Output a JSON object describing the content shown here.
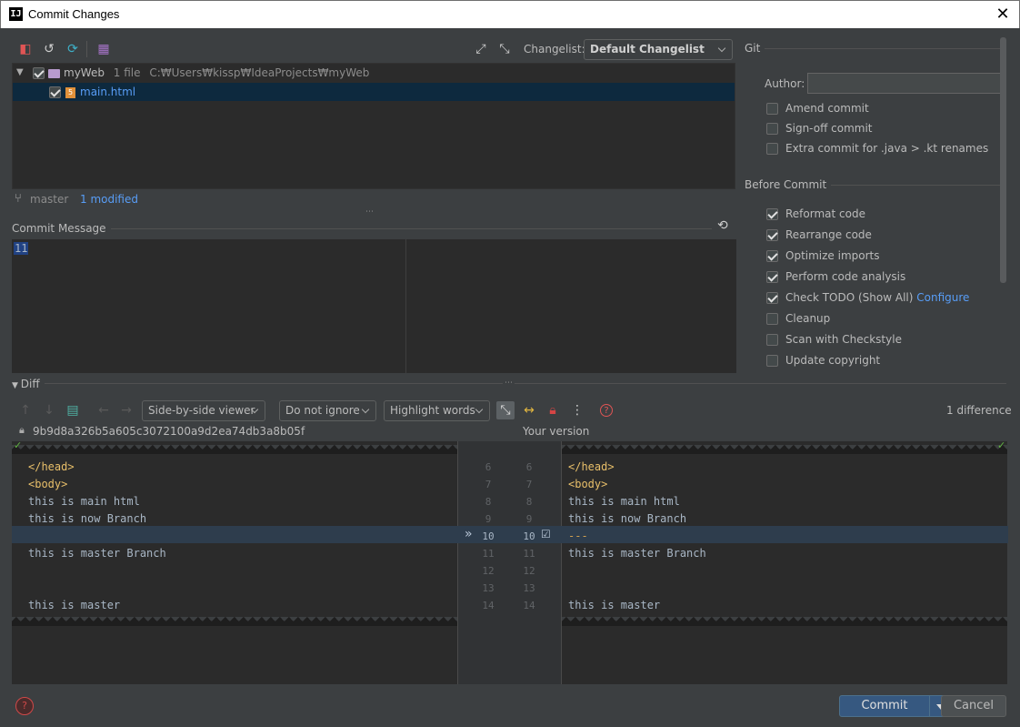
{
  "window": {
    "title": "Commit Changes",
    "app_icon": "IJ"
  },
  "changes": {
    "changelist_label": "Changelist:",
    "changelist_value": "Default Changelist",
    "root": {
      "name": "myWeb",
      "count": "1 file",
      "path": "C:₩Users₩kissp₩IdeaProjects₩myWeb"
    },
    "file": {
      "name": "main.html"
    },
    "branch": "master",
    "modified": "1 modified"
  },
  "commit_message": {
    "label": "Commit Message",
    "value": "11"
  },
  "git": {
    "section": "Git",
    "author_label": "Author:",
    "author_value": "",
    "options": [
      {
        "label": "Amend commit",
        "checked": false
      },
      {
        "label": "Sign-off commit",
        "checked": false
      },
      {
        "label": "Extra commit for .java > .kt renames",
        "checked": false
      }
    ]
  },
  "before_commit": {
    "section": "Before Commit",
    "options": [
      {
        "label": "Reformat code",
        "checked": true
      },
      {
        "label": "Rearrange code",
        "checked": true
      },
      {
        "label": "Optimize imports",
        "checked": true
      },
      {
        "label": "Perform code analysis",
        "checked": true
      },
      {
        "label": "Check TODO (Show All)",
        "checked": true,
        "link": "Configure"
      },
      {
        "label": "Cleanup",
        "checked": false
      },
      {
        "label": "Scan with Checkstyle",
        "checked": false
      },
      {
        "label": "Update copyright",
        "checked": false
      }
    ]
  },
  "diff": {
    "section": "Diff",
    "viewer": "Side-by-side viewer",
    "ignore": "Do not ignore",
    "highlight": "Highlight words",
    "difference_count": "1 difference",
    "left_title": "9b9d8a326b5a605c3072100a9d2ea74db3a8b05f",
    "right_title": "Your version",
    "left_lines": [
      {
        "n": "6",
        "text": "</head>"
      },
      {
        "n": "7",
        "text": "<body>"
      },
      {
        "n": "8",
        "text": "this is main html"
      },
      {
        "n": "9",
        "text": "this is now Branch"
      },
      {
        "n": "10",
        "text": ""
      },
      {
        "n": "11",
        "text": "this is master Branch"
      },
      {
        "n": "12",
        "text": ""
      },
      {
        "n": "13",
        "text": ""
      },
      {
        "n": "14",
        "text": "this is master"
      }
    ],
    "right_lines": [
      {
        "n": "6",
        "text": "</head>"
      },
      {
        "n": "7",
        "text": "<body>"
      },
      {
        "n": "8",
        "text": "this is main html"
      },
      {
        "n": "9",
        "text": "this is now Branch"
      },
      {
        "n": "10",
        "text": "---"
      },
      {
        "n": "11",
        "text": "this is master Branch"
      },
      {
        "n": "12",
        "text": ""
      },
      {
        "n": "13",
        "text": ""
      },
      {
        "n": "14",
        "text": "this is master"
      }
    ]
  },
  "buttons": {
    "commit": "Commit",
    "cancel": "Cancel"
  },
  "colors": {
    "accent": "#365880",
    "link": "#589df6",
    "selection": "#0d293e"
  }
}
